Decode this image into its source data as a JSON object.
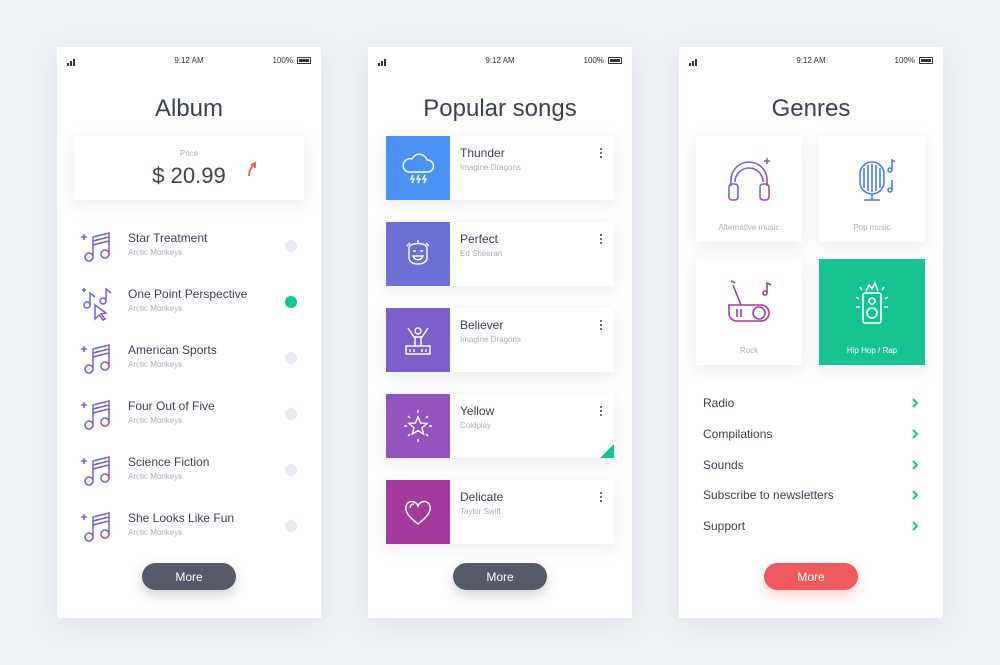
{
  "status_bar": {
    "time": "9:12 AM",
    "battery": "100%"
  },
  "album": {
    "title": "Album",
    "price_label": "Price",
    "price": "$ 20.99",
    "tracks": [
      {
        "title": "Star Treatment",
        "artist": "Arctic Monkeys",
        "active": false
      },
      {
        "title": "One Point Perspective",
        "artist": "Arctic Monkeys",
        "active": true
      },
      {
        "title": "American Sports",
        "artist": "Arctic Monkeys",
        "active": false
      },
      {
        "title": "Four Out of Five",
        "artist": "Arctic Monkeys",
        "active": false
      },
      {
        "title": "Science Fiction",
        "artist": "Arctic Monkeys",
        "active": false
      },
      {
        "title": "She Looks Like Fun",
        "artist": "Arctic Monkeys",
        "active": false
      }
    ],
    "more_label": "More"
  },
  "songs": {
    "title": "Popular songs",
    "items": [
      {
        "title": "Thunder",
        "artist": "Imagine Dragons",
        "color": "#4a93f4",
        "icon": "thunder-cloud-icon"
      },
      {
        "title": "Perfect",
        "artist": "Ed Sheeran",
        "color": "#6c6fd6",
        "icon": "smiling-face-icon"
      },
      {
        "title": "Believer",
        "artist": "Imagine Dragons",
        "color": "#7c5fc8",
        "icon": "raised-arms-icon"
      },
      {
        "title": "Yellow",
        "artist": "Coldplay",
        "color": "#9353bd",
        "icon": "star-icon"
      },
      {
        "title": "Delicate",
        "artist": "Taylor Swift",
        "color": "#a43b9c",
        "icon": "heart-icon"
      }
    ],
    "more_label": "More"
  },
  "genres": {
    "title": "Genres",
    "tiles": [
      {
        "label": "Alternative music",
        "icon": "headphones-icon",
        "selected": false
      },
      {
        "label": "Pop music",
        "icon": "microphone-icon",
        "selected": false
      },
      {
        "label": "Rock",
        "icon": "guitar-icon",
        "selected": false
      },
      {
        "label": "Hip Hop / Rap",
        "icon": "speaker-icon",
        "selected": true
      }
    ],
    "menu": [
      "Radio",
      "Compilations",
      "Sounds",
      "Subscribe to newsletters",
      "Support"
    ],
    "more_label": "More"
  },
  "colors": {
    "accent_green": "#17c393",
    "accent_red": "#ee5a5e",
    "dark_button": "#545a67",
    "icon_gradient_start": "#4a7cf0",
    "icon_gradient_end": "#b13aa8"
  }
}
